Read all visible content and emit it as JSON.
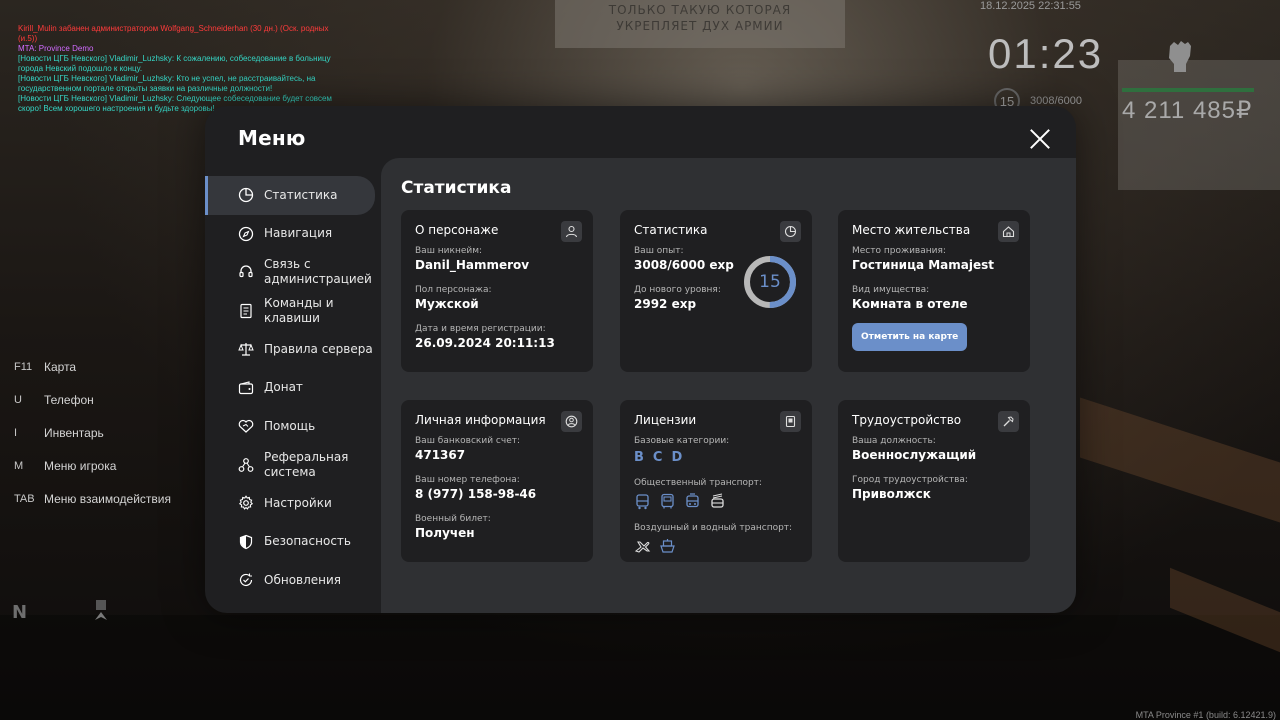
{
  "background": {
    "poster_text": "ТОЛЬКО ТАКУЮ КОТОРАЯ УКРЕПЛЯЕТ ДУХ АРМИИ"
  },
  "chat": [
    {
      "text": "Kirill_Mulin забанен администратором Wolfgang_Schneiderhan (30 дн.) (Оск. родных (и.5))",
      "color": "#ff3b3b"
    },
    {
      "text": "MTA: Province Demo",
      "color": "#d16bff"
    },
    {
      "text": "[Новости ЦГБ Невского] Vladimir_Luzhsky: К сожалению, собеседование в больницу города Невский подошло к концу.",
      "color": "#35d6c5"
    },
    {
      "text": "[Новости ЦГБ Невского] Vladimir_Luzhsky: Кто не успел, не расстраивайтесь, на государственном портале открыты заявки на различные должности!",
      "color": "#35d6c5"
    },
    {
      "text": "[Новости ЦГБ Невского] Vladimir_Luzhsky: Следующее собеседование будет совсем скоро! Всем хорошего настроения и будьте здоровы!",
      "color": "#35d6c5"
    }
  ],
  "hud": {
    "date": "18.12.2025 22:31:55",
    "time": "01:23",
    "level": "15",
    "exp": "3008/6000",
    "money": "4 211 485₽"
  },
  "hints": [
    {
      "key": "F11",
      "label": "Карта"
    },
    {
      "key": "U",
      "label": "Телефон"
    },
    {
      "key": "I",
      "label": "Инвентарь"
    },
    {
      "key": "M",
      "label": "Меню игрока"
    },
    {
      "key": "TAB",
      "label": "Меню взаимодействия"
    }
  ],
  "compass": "N",
  "build": "MTA Province #1 (build: 6.12421.9)",
  "menu": {
    "title": "Меню",
    "section_title": "Статистика",
    "nav": [
      {
        "label": "Статистика",
        "icon": "pie-chart-icon",
        "active": true
      },
      {
        "label": "Навигация",
        "icon": "compass-icon",
        "active": false
      },
      {
        "label": "Связь с\nадминистрацией",
        "icon": "headset-icon",
        "active": false
      },
      {
        "label": "Команды и\nклавиши",
        "icon": "document-icon",
        "active": false
      },
      {
        "label": "Правила сервера",
        "icon": "scales-icon",
        "active": false
      },
      {
        "label": "Донат",
        "icon": "wallet-icon",
        "active": false
      },
      {
        "label": "Помощь",
        "icon": "handshake-icon",
        "active": false
      },
      {
        "label": "Реферальная\nсистема",
        "icon": "network-icon",
        "active": false
      },
      {
        "label": "Настройки",
        "icon": "gear-icon",
        "active": false
      },
      {
        "label": "Безопасность",
        "icon": "shield-icon",
        "active": false
      },
      {
        "label": "Обновления",
        "icon": "refresh-check-icon",
        "active": false
      }
    ],
    "cards": {
      "character": {
        "title": "О персонаже",
        "nickname_label": "Ваш никнейм:",
        "nickname": "Danil_Hammerov",
        "gender_label": "Пол персонажа:",
        "gender": "Мужской",
        "reg_label": "Дата и время регистрации:",
        "reg": "26.09.2024 20:11:13"
      },
      "stats": {
        "title": "Статистика",
        "exp_label": "Ваш опыт:",
        "exp": "3008/6000 exp",
        "next_label": "До нового уровня:",
        "next": "2992 exp",
        "level": "15",
        "progress": 0.501
      },
      "residence": {
        "title": "Место жительства",
        "place_label": "Место проживания:",
        "place": "Гостиница Mamajest",
        "property_label": "Вид имущества:",
        "property": "Комната в отеле",
        "button": "Отметить на карте"
      },
      "personal": {
        "title": "Личная информация",
        "bank_label": "Ваш банковский счет:",
        "bank": "471367",
        "phone_label": "Ваш номер телефона:",
        "phone": "8 (977) 158-98-46",
        "military_label": "Военный билет:",
        "military": "Получен"
      },
      "licenses": {
        "title": "Лицензии",
        "base_label": "Базовые категории:",
        "categories": [
          "B",
          "C",
          "D"
        ],
        "public_label": "Общественный транспорт:",
        "public_icons": [
          "bus-icon",
          "bus-front-icon",
          "tram-icon",
          "trolleybus-icon"
        ],
        "air_label": "Воздушный и водный транспорт:",
        "air_icons": [
          "airplane-icon",
          "boat-icon"
        ]
      },
      "employment": {
        "title": "Трудоустройство",
        "position_label": "Ваша должность:",
        "position": "Военнослужащий",
        "city_label": "Город трудоустройства:",
        "city": "Приволжск"
      }
    }
  }
}
